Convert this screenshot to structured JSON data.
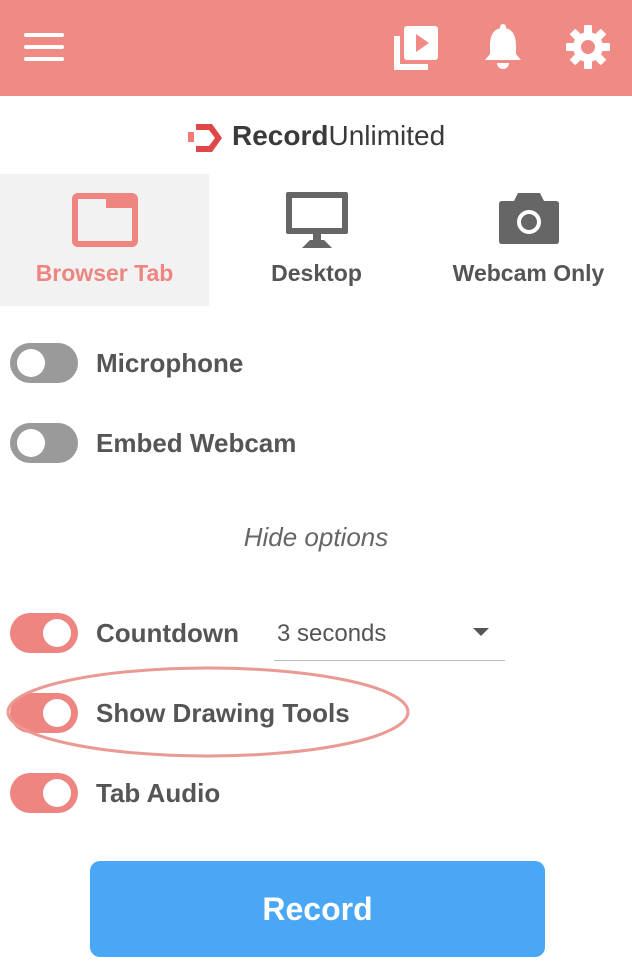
{
  "header": {
    "menu_icon": "hamburger-menu-icon",
    "video_icon": "video-library-icon",
    "bell_icon": "notification-bell-icon",
    "gear_icon": "settings-gear-icon"
  },
  "logo": {
    "bold": "Record",
    "light": "Unlimited"
  },
  "modes": [
    {
      "label": "Browser Tab",
      "icon": "browser-tab-icon",
      "active": true
    },
    {
      "label": "Desktop",
      "icon": "desktop-monitor-icon",
      "active": false
    },
    {
      "label": "Webcam Only",
      "icon": "camera-icon",
      "active": false
    }
  ],
  "options": {
    "microphone": {
      "label": "Microphone",
      "on": false
    },
    "embed_webcam": {
      "label": "Embed Webcam",
      "on": false
    },
    "hide_options": "Hide options",
    "countdown": {
      "label": "Countdown",
      "on": true,
      "value": "3 seconds"
    },
    "drawing_tools": {
      "label": "Show Drawing Tools",
      "on": true
    },
    "tab_audio": {
      "label": "Tab Audio",
      "on": true
    }
  },
  "record_button": "Record",
  "colors": {
    "brand": "#f08a84",
    "accent_button": "#4aa7f5",
    "toggle_off": "#9a9a9a",
    "toggle_on": "#ef8580"
  }
}
